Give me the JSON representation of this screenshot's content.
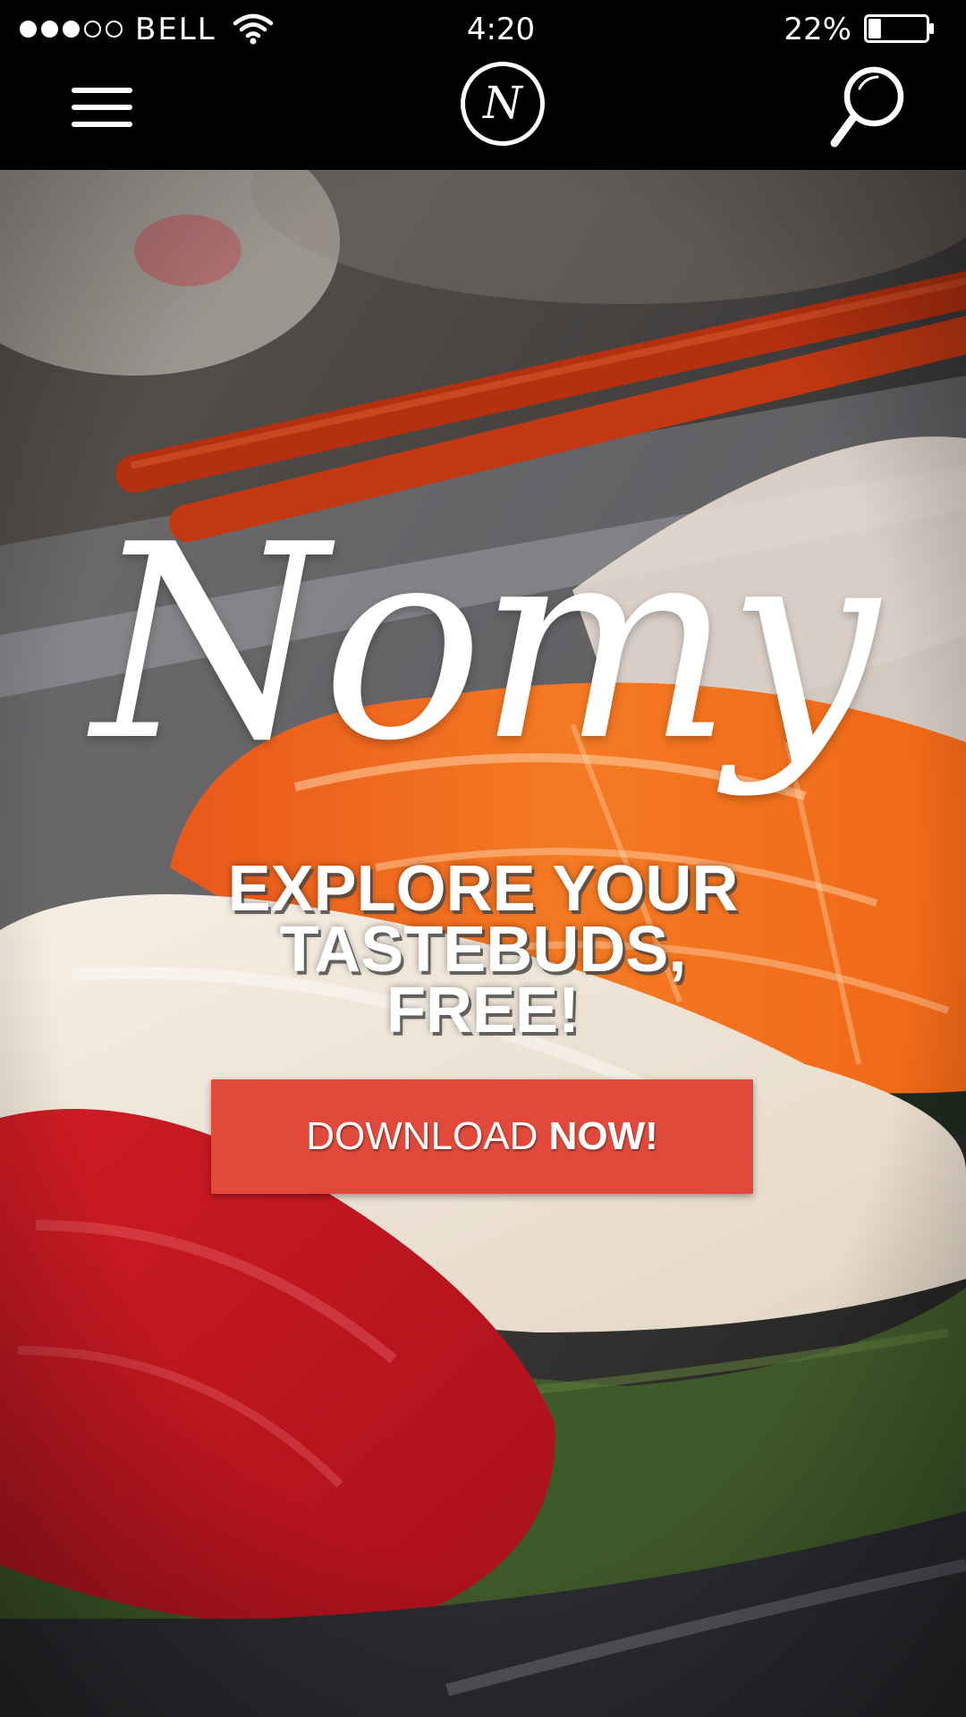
{
  "status_bar": {
    "signal_dots": [
      true,
      true,
      true,
      false,
      false
    ],
    "carrier": "BELL",
    "time": "4:20",
    "battery_percent": "22%",
    "battery_level": 0.22,
    "icons": [
      "wifi-icon",
      "battery-icon"
    ]
  },
  "nav": {
    "menu_icon": "hamburger-menu-icon",
    "logo_letter": "N",
    "search_icon": "search-icon"
  },
  "hero": {
    "title": "Nomy",
    "tagline_lines": [
      "EXPLORE YOUR",
      "TASTEBUDS,",
      "FREE!"
    ],
    "button": {
      "label_regular": "DOWNLOAD",
      "label_bold": "NOW!"
    }
  },
  "colors": {
    "bars_background": "#000000",
    "button_background": "#e14a3b",
    "text": "#ffffff"
  }
}
